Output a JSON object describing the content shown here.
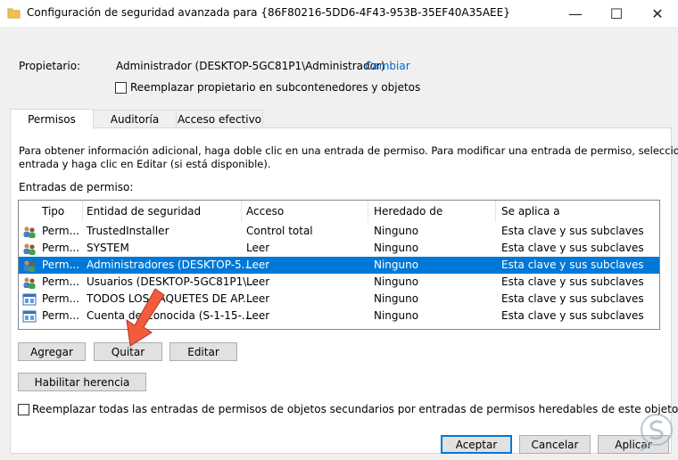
{
  "window": {
    "title": "Configuración de seguridad avanzada para {86F80216-5DD6-4F43-953B-35EF40A35AEE}",
    "minimize": "—",
    "maximize": "☐",
    "close": "✕"
  },
  "owner": {
    "label": "Propietario:",
    "value": "Administrador (DESKTOP-5GC81P1\\Administrador)",
    "change_link": "Cambiar",
    "replace_checkbox_label": "Reemplazar propietario en subcontenedores y objetos"
  },
  "tabs": [
    {
      "label": "Permisos",
      "active": true
    },
    {
      "label": "Auditoría",
      "active": false
    },
    {
      "label": "Acceso efectivo",
      "active": false
    }
  ],
  "info_text_1": "Para obtener información adicional, haga doble clic en una entrada de permiso. Para modificar una entrada de permiso, seleccione la",
  "info_text_2": "entrada y haga clic en Editar (si está disponible).",
  "entries_label": "Entradas de permiso:",
  "table": {
    "headers": [
      "Tipo",
      "Entidad de seguridad",
      "Acceso",
      "Heredado de",
      "Se aplica a"
    ],
    "rows": [
      {
        "icon": "users-icon",
        "tipo": "Perm...",
        "entidad": "TrustedInstaller",
        "acceso": "Control total",
        "heredado": "Ninguno",
        "aplica": "Esta clave y sus subclaves",
        "selected": false
      },
      {
        "icon": "users-icon",
        "tipo": "Perm...",
        "entidad": "SYSTEM",
        "acceso": "Leer",
        "heredado": "Ninguno",
        "aplica": "Esta clave y sus subclaves",
        "selected": false
      },
      {
        "icon": "users-icon",
        "tipo": "Perm...",
        "entidad": "Administradores (DESKTOP-5...",
        "acceso": "Leer",
        "heredado": "Ninguno",
        "aplica": "Esta clave y sus subclaves",
        "selected": true
      },
      {
        "icon": "users-icon",
        "tipo": "Perm...",
        "entidad": "Usuarios (DESKTOP-5GC81P1\\...",
        "acceso": "Leer",
        "heredado": "Ninguno",
        "aplica": "Esta clave y sus subclaves",
        "selected": false
      },
      {
        "icon": "package-icon",
        "tipo": "Perm...",
        "entidad": "TODOS LOS PAQUETES DE AP...",
        "acceso": "Leer",
        "heredado": "Ninguno",
        "aplica": "Esta clave y sus subclaves",
        "selected": false
      },
      {
        "icon": "package-icon",
        "tipo": "Perm...",
        "entidad": "Cuenta desconocida (S-1-15-...",
        "acceso": "Leer",
        "heredado": "Ninguno",
        "aplica": "Esta clave y sus subclaves",
        "selected": false
      }
    ]
  },
  "buttons": {
    "add": "Agregar",
    "remove": "Quitar",
    "edit": "Editar",
    "enable_inheritance": "Habilitar herencia",
    "accept": "Aceptar",
    "cancel": "Cancelar",
    "apply": "Aplicar"
  },
  "replace_all_checkbox_label": "Reemplazar todas las entradas de permisos de objetos secundarios por entradas de permisos heredables de este objeto",
  "colors": {
    "selection": "#0078d7",
    "link": "#0066cc",
    "arrow": "#f25c3c"
  }
}
